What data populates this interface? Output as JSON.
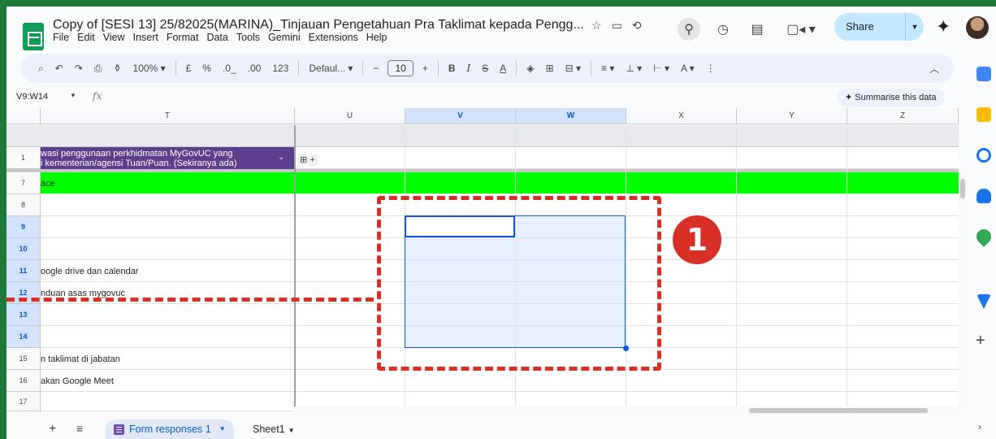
{
  "header": {
    "title": "Copy of [SESI 13] 25/82025(MARINA)_Tinjauan Pengetahuan Pra Taklimat kepada Pengg...",
    "menu": [
      "File",
      "Edit",
      "View",
      "Insert",
      "Format",
      "Data",
      "Tools",
      "Gemini",
      "Extensions",
      "Help"
    ],
    "share_label": "Share"
  },
  "toolbar": {
    "zoom": "100%",
    "currency": "£",
    "percent": "%",
    "dec_decrease": ".0_",
    "dec_increase": ".00",
    "number_format": "123",
    "font": "Defaul...",
    "minus": "−",
    "font_size": "10",
    "plus": "+",
    "bold": "B",
    "italic": "I",
    "strike": "S",
    "text_color": "A"
  },
  "formula_bar": {
    "name_box": "V9:W14",
    "fx": "fx",
    "summarise_label": "Summarise this data"
  },
  "columns": [
    {
      "label": "T",
      "selected": false
    },
    {
      "label": "U",
      "selected": false
    },
    {
      "label": "V",
      "selected": true
    },
    {
      "label": "W",
      "selected": true
    },
    {
      "label": "X",
      "selected": false
    },
    {
      "label": "Y",
      "selected": false
    },
    {
      "label": "Z",
      "selected": false
    }
  ],
  "header_cell": {
    "line1": "wasi penggunaan perkhidmatan MyGovUC yang",
    "line2": "i kementerian/agensi Tuan/Puan. (Sekiranya ada)"
  },
  "rows": [
    {
      "num": "1",
      "text": "",
      "selected": false
    },
    {
      "num": "7",
      "text": "ace",
      "selected": false
    },
    {
      "num": "8",
      "text": "",
      "selected": false
    },
    {
      "num": "9",
      "text": "",
      "selected": true
    },
    {
      "num": "10",
      "text": "",
      "selected": true
    },
    {
      "num": "11",
      "text": "oogle drive dan calendar",
      "selected": true
    },
    {
      "num": "12",
      "text": "nduan asas mygovuc",
      "selected": true
    },
    {
      "num": "13",
      "text": "",
      "selected": true
    },
    {
      "num": "14",
      "text": "",
      "selected": true
    },
    {
      "num": "15",
      "text": "n taklimat di jabatan",
      "selected": false
    },
    {
      "num": "16",
      "text": "akan Google Meet",
      "selected": false
    },
    {
      "num": "17",
      "text": "",
      "selected": false
    }
  ],
  "annotation": {
    "number": "1",
    "color": "#d93025"
  },
  "tabs": {
    "active": "Form responses 1",
    "other": "Sheet1"
  },
  "colors": {
    "accent": "#0b57d0",
    "highlight_row": "#00ff00",
    "header_purple": "#5b3f8c"
  }
}
